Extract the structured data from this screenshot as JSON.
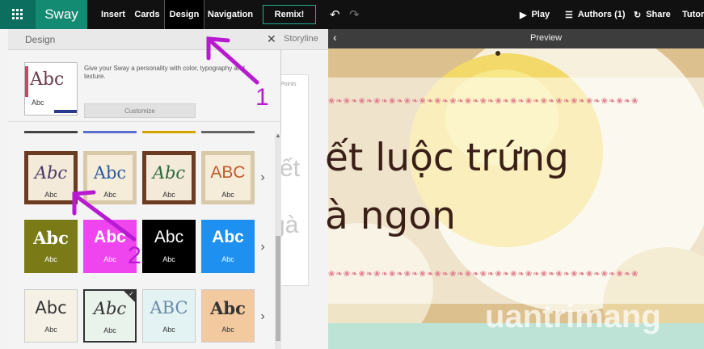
{
  "app": {
    "name": "Sway"
  },
  "toolbar": {
    "insert": "Insert",
    "cards": "Cards",
    "design": "Design",
    "navigation": "Navigation",
    "remix": "Remix!",
    "play": "Play",
    "authors": "Authors (1)",
    "share": "Share",
    "tutorials": "Tutorials"
  },
  "design_panel": {
    "title": "Design",
    "intro": "Give your Sway a personality with color, typography and texture.",
    "customize": "Customize",
    "style_rows": [
      [
        {
          "big": "Abc",
          "small": "Abc"
        },
        {
          "big": "Abc",
          "small": "Abc"
        },
        {
          "big": "Abc",
          "small": "Abc"
        },
        {
          "big": "ABC",
          "small": "Abc"
        }
      ],
      [
        {
          "big": "Abc",
          "small": "Abc"
        },
        {
          "big": "Abc",
          "small": "Abc"
        },
        {
          "big": "Abc",
          "small": "Abc"
        },
        {
          "big": "Abc",
          "small": "Abc"
        }
      ],
      [
        {
          "big": "Abc",
          "small": "Abc"
        },
        {
          "big": "Abc",
          "small": "Abc"
        },
        {
          "big": "ABC",
          "small": "Abc"
        },
        {
          "big": "Abc",
          "small": "Abc"
        }
      ]
    ],
    "intro_thumb": {
      "big": "Abc",
      "small": "Abc"
    }
  },
  "storyline": {
    "label": "Storyline",
    "points": "Points",
    "ghost1": "yết",
    "ghost2": "gà"
  },
  "preview": {
    "label": "Preview",
    "headline_line1": "ết luộc trứng",
    "headline_line2": "à ngon",
    "watermark": "uantrimang"
  },
  "annotations": {
    "one": "1",
    "two": "2"
  },
  "colors": {
    "brand": "#138a72",
    "accent_arrow": "#b71ad1"
  }
}
